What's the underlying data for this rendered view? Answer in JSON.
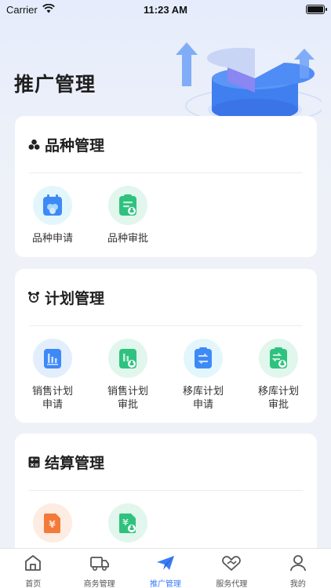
{
  "status_bar": {
    "carrier": "Carrier",
    "time": "11:23 AM"
  },
  "page": {
    "title": "推广管理"
  },
  "sections": [
    {
      "title": "品种管理",
      "icon": "cluster-icon",
      "items": [
        {
          "label_lines": [
            "品种申请"
          ],
          "icon": "variety-apply-icon"
        },
        {
          "label_lines": [
            "品种审批"
          ],
          "icon": "variety-approve-icon"
        }
      ]
    },
    {
      "title": "计划管理",
      "icon": "alarm-clock-icon",
      "items": [
        {
          "label_lines": [
            "销售计划",
            "申请"
          ],
          "icon": "sales-plan-apply-icon"
        },
        {
          "label_lines": [
            "销售计划",
            "审批"
          ],
          "icon": "sales-plan-approve-icon"
        },
        {
          "label_lines": [
            "移库计划",
            "申请"
          ],
          "icon": "transfer-plan-apply-icon"
        },
        {
          "label_lines": [
            "移库计划",
            "审批"
          ],
          "icon": "transfer-plan-approve-icon"
        }
      ]
    },
    {
      "title": "结算管理",
      "icon": "calculator-icon",
      "items": [
        {
          "label_lines": [],
          "icon": "settlement-apply-icon"
        },
        {
          "label_lines": [],
          "icon": "settlement-approve-icon"
        }
      ]
    }
  ],
  "tabs": [
    {
      "label": "首页",
      "icon": "home-icon",
      "active": false
    },
    {
      "label": "商务管理",
      "icon": "truck-icon",
      "active": false
    },
    {
      "label": "推广管理",
      "icon": "paper-plane-icon",
      "active": true
    },
    {
      "label": "服务代理",
      "icon": "handshake-icon",
      "active": false
    },
    {
      "label": "我的",
      "icon": "user-icon",
      "active": false
    }
  ],
  "colors": {
    "accent": "#3a7cf5",
    "blue_icon": "#3d8af7",
    "green_icon": "#2ec27e",
    "orange_icon": "#f47a3a"
  }
}
